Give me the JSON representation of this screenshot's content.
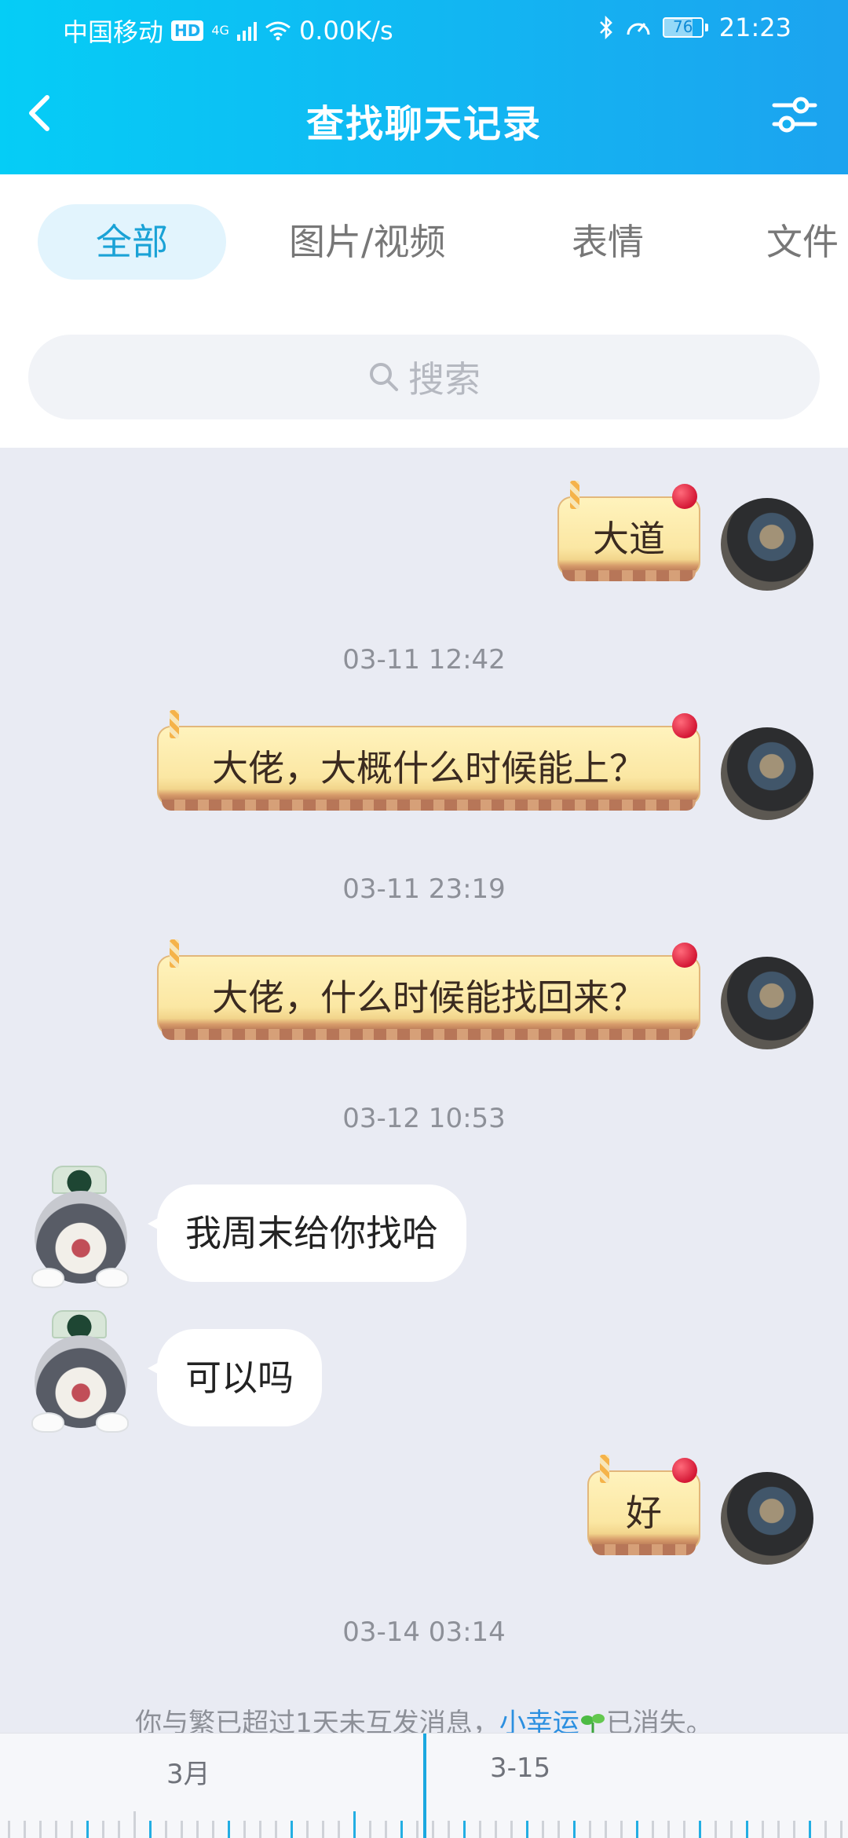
{
  "status_bar": {
    "carrier": "中国移动",
    "hd": "HD",
    "network": "4G",
    "speed": "0.00K/s",
    "battery": "76",
    "time": "21:23"
  },
  "nav": {
    "title": "查找聊天记录"
  },
  "tabs": [
    {
      "label": "全部",
      "active": true
    },
    {
      "label": "图片/视频",
      "active": false
    },
    {
      "label": "表情",
      "active": false
    },
    {
      "label": "文件",
      "active": false
    }
  ],
  "search": {
    "placeholder": "搜索"
  },
  "messages": [
    {
      "from": "me",
      "text": "大道"
    },
    {
      "time": "03-11 12:42"
    },
    {
      "from": "me",
      "text": "大佬，大概什么时候能上？"
    },
    {
      "time": "03-11 23:19"
    },
    {
      "from": "me",
      "text": "大佬，什么时候能找回来？"
    },
    {
      "time": "03-12 10:53"
    },
    {
      "from": "other",
      "text": "我周末给你找哈"
    },
    {
      "from": "other",
      "text": "可以吗"
    },
    {
      "from": "me",
      "text": "好"
    },
    {
      "time": "03-14 03:14"
    }
  ],
  "system_note": {
    "prefix": "你与繁已超过1天未互发消息，",
    "link": "小幸运",
    "suffix": "已消失。"
  },
  "timeline": {
    "month_label": "3月",
    "date_label": "3-15"
  },
  "colors": {
    "header_start": "#05cdf6",
    "header_end": "#1ca3ef",
    "active_tab": "#1aa2d6",
    "chat_bg": "#e9ebf3",
    "link": "#2b8fe0"
  }
}
